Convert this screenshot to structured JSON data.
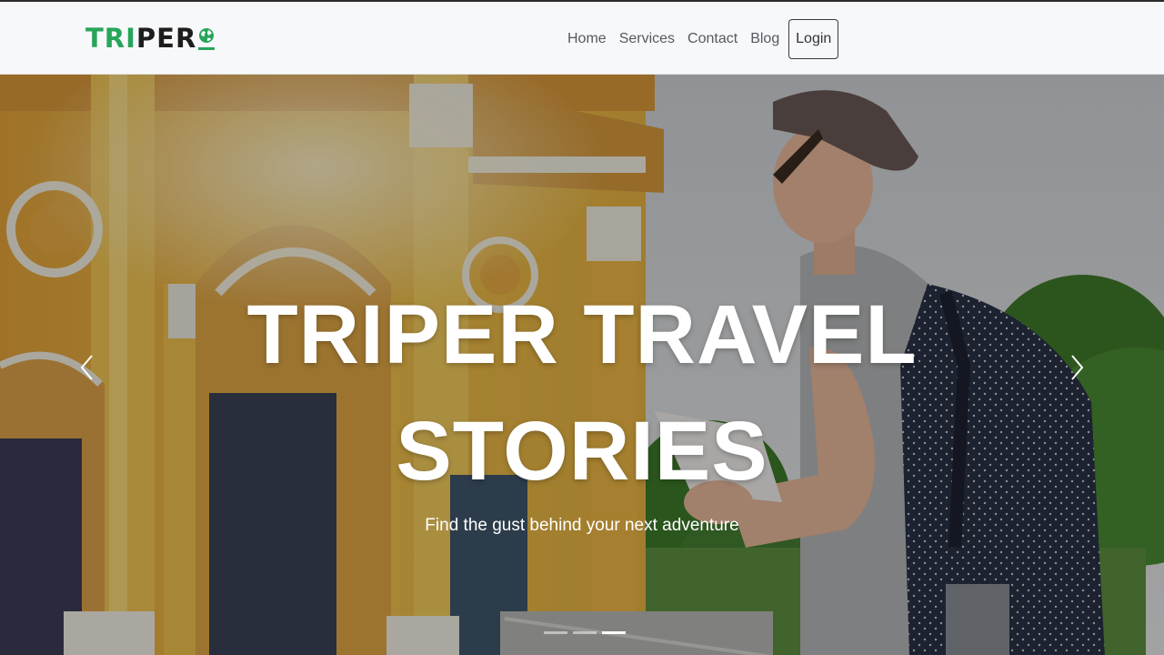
{
  "navbar": {
    "brand": {
      "part1": "TRI",
      "part2": "PER",
      "icon": "globe-icon"
    },
    "links": [
      {
        "label": "Home"
      },
      {
        "label": "Services"
      },
      {
        "label": "Contact"
      },
      {
        "label": "Blog"
      }
    ],
    "login_label": "Login"
  },
  "hero": {
    "title_line1": "TRIPER TRAVEL",
    "title_line2": "STORIES",
    "subtitle": "Find the gust behind your next adventure",
    "prev_icon": "chevron-left-icon",
    "next_icon": "chevron-right-icon",
    "indicators": [
      {
        "active": false
      },
      {
        "active": false
      },
      {
        "active": true
      }
    ]
  },
  "colors": {
    "brand_green": "#27a559",
    "brand_dark": "#1d1d1d",
    "navbar_bg": "#f7f8fa"
  }
}
